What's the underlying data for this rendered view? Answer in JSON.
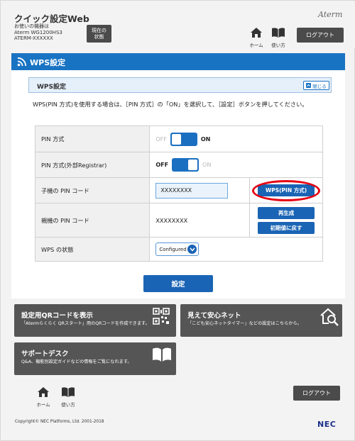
{
  "header": {
    "app_title": "クイック設定Web",
    "device_line1": "お使いの機器は",
    "device_line2": "Aterm WG1200HS3",
    "device_line3": "ATERM-XXXXXX",
    "status_label_line1": "現在の",
    "status_label_line2": "状態",
    "brand": "Aterm",
    "home_label": "ホーム",
    "manual_label": "使い方",
    "logout_label": "ログアウト"
  },
  "page": {
    "title": "WPS設定"
  },
  "section": {
    "title": "WPS設定",
    "close_label": "閉じる",
    "description": "WPS(PIN 方式)を使用する場合は、［PIN 方式］の「ON」を選択して、［設定］ボタンを押してください。"
  },
  "rows": {
    "pin_method": {
      "label": "PIN 方式",
      "off": "OFF",
      "on": "ON",
      "state": "on"
    },
    "pin_registrar": {
      "label": "PIN 方式(外部Registrar)",
      "off": "OFF",
      "on": "ON",
      "state": "off"
    },
    "child_pin": {
      "label": "子機の PIN コード",
      "value": "XXXXXXXX",
      "button": "WPS(PIN 方式)"
    },
    "parent_pin": {
      "label": "親機の PIN コード",
      "value": "XXXXXXXX",
      "regen_button": "再生成",
      "reset_button": "初期値に戻す"
    },
    "wps_status": {
      "label": "WPS の状態",
      "selected": "Configured"
    }
  },
  "set_button": "設定",
  "cards": {
    "qr": {
      "title": "設定用QRコードを表示",
      "subtitle": "「Atermらくらく QRスタート」用のQRコードを作成できます。"
    },
    "mieru": {
      "title": "見えて安心ネット",
      "subtitle": "「こども安心ネットタイマー」などの設定はこちらから。"
    },
    "support": {
      "title": "サポートデスク",
      "subtitle": "Q&A、機能別設定ガイドなどの情報をご覧になれます。"
    }
  },
  "footer": {
    "home_label": "ホーム",
    "manual_label": "使い方",
    "logout_label": "ログアウト",
    "copyright": "Copyright© NEC Platforms, Ltd. 2001-2018",
    "nec_logo": "NEC"
  },
  "colors": {
    "accent_blue": "#1973c3",
    "button_dark": "#4b4b4b",
    "highlight_red": "#e60012",
    "card_gray": "#555555"
  }
}
